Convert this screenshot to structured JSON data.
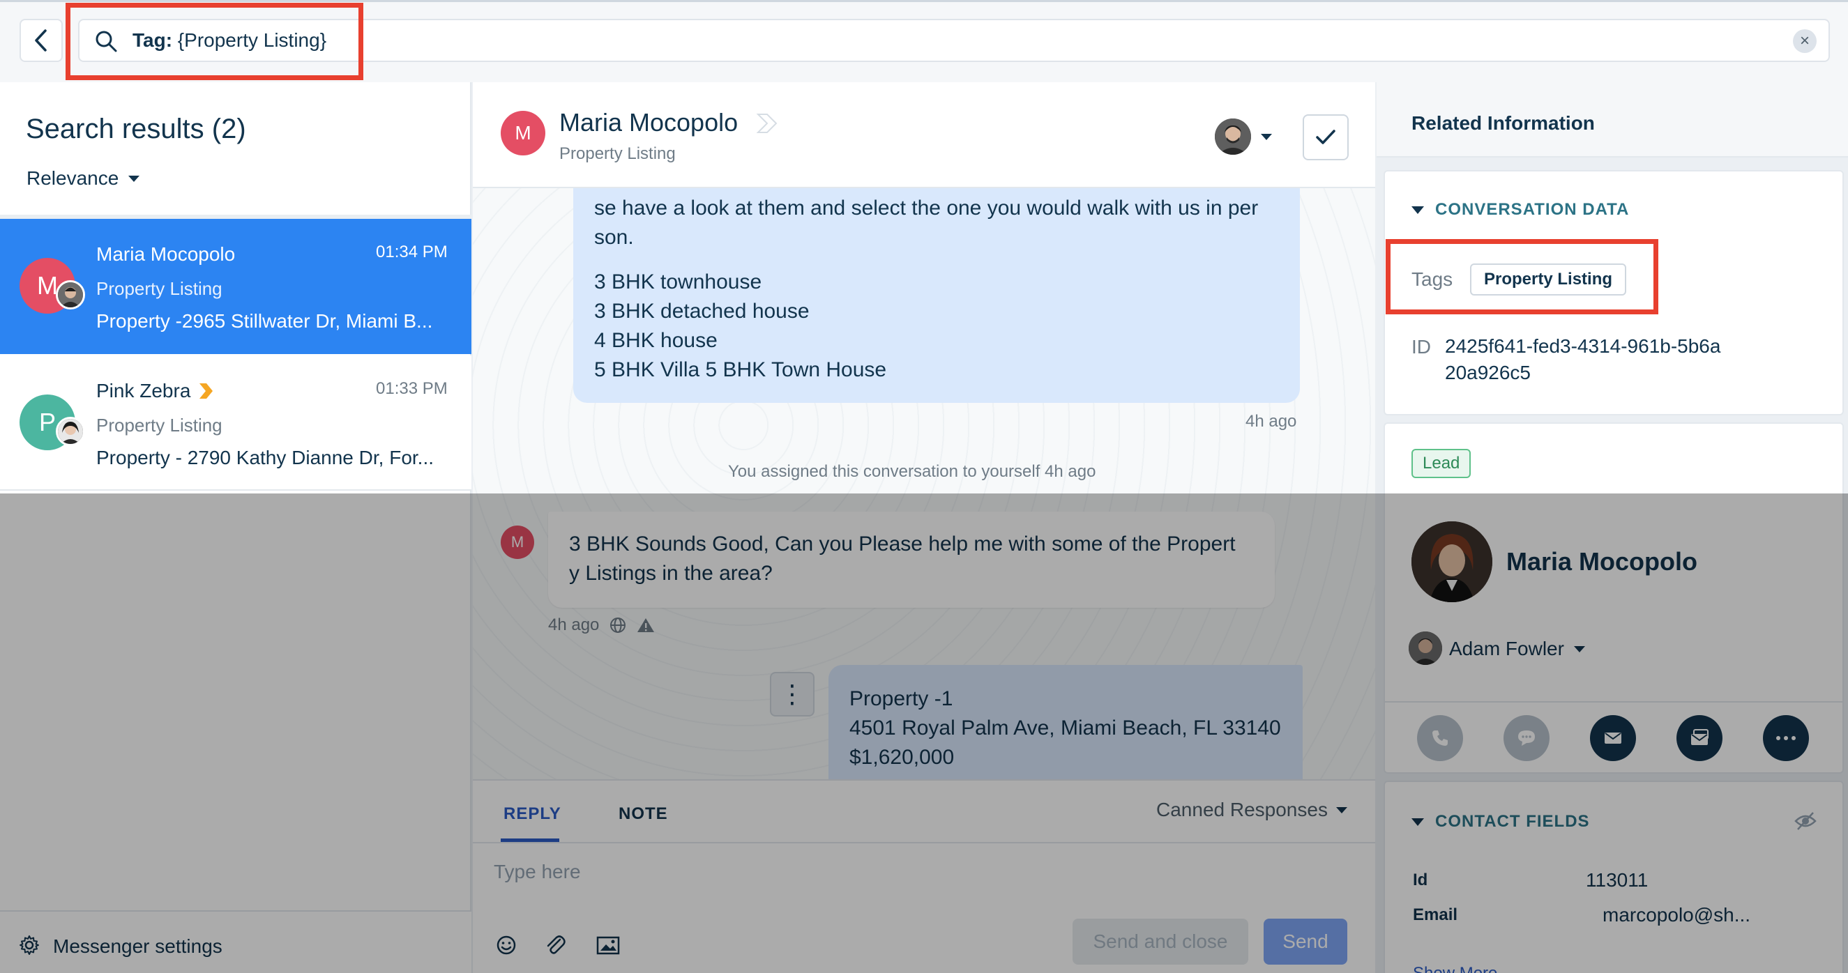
{
  "search": {
    "prefix": "Tag:",
    "query": " {Property Listing}"
  },
  "results": {
    "title": "Search results (2)",
    "sort_label": "Relevance",
    "items": [
      {
        "avatar_letter": "M",
        "name": "Maria Mocopolo",
        "time": "01:34 PM",
        "tag": "Property Listing",
        "snippet": "Property -2965 Stillwater Dr, Miami B...",
        "avatar_color": "#e44e64"
      },
      {
        "avatar_letter": "P",
        "name": "Pink Zebra",
        "time": "01:33 PM",
        "tag": "Property Listing",
        "snippet": "Property - 2790 Kathy Dianne Dr, For...",
        "avatar_color": "#4cb6a0"
      }
    ],
    "settings_label": "Messenger settings"
  },
  "chat": {
    "header": {
      "avatar_letter": "M",
      "name": "Maria Mocopolo",
      "tag": "Property Listing"
    },
    "outgoing1": {
      "lines": [
        "se have a look at them and select the one you would walk with us in per",
        "son."
      ],
      "list": [
        "3 BHK townhouse",
        "3 BHK detached house",
        "4 BHK house",
        "5 BHK Villa 5 BHK Town House"
      ],
      "time": "4h ago"
    },
    "system": "You assigned this conversation to yourself 4h ago",
    "incoming": {
      "avatar_letter": "M",
      "lines": [
        "3 BHK Sounds Good, Can you Please help me with some of the Propert",
        "y Listings in the area?"
      ],
      "time": "4h ago"
    },
    "outgoing2": {
      "lines": [
        "Property -1",
        "4501 Royal Palm Ave, Miami Beach, FL 33140",
        "$1,620,000"
      ]
    },
    "reply": {
      "tab_reply": "REPLY",
      "tab_note": "NOTE",
      "canned": "Canned Responses",
      "placeholder": "Type here",
      "send_close": "Send and close",
      "send": "Send"
    }
  },
  "related": {
    "title": "Related Information",
    "conversation_data": {
      "title": "CONVERSATION DATA",
      "tags_label": "Tags",
      "tag_value": "Property Listing",
      "id_label": "ID",
      "id_value": "2425f641-fed3-4314-961b-5b6a20a926c5"
    },
    "contact": {
      "badge": "Lead",
      "name": "Maria Mocopolo",
      "owner": "Adam Fowler"
    },
    "contact_fields": {
      "title": "CONTACT FIELDS",
      "id_label": "Id",
      "id_value": "113011",
      "email_label": "Email",
      "email_value": "marcopolo@sh...",
      "show_more": "Show More"
    }
  },
  "colors": {
    "accent": "#2c84f2",
    "highlight": "#e8402f",
    "brand_dark": "#12344d"
  }
}
